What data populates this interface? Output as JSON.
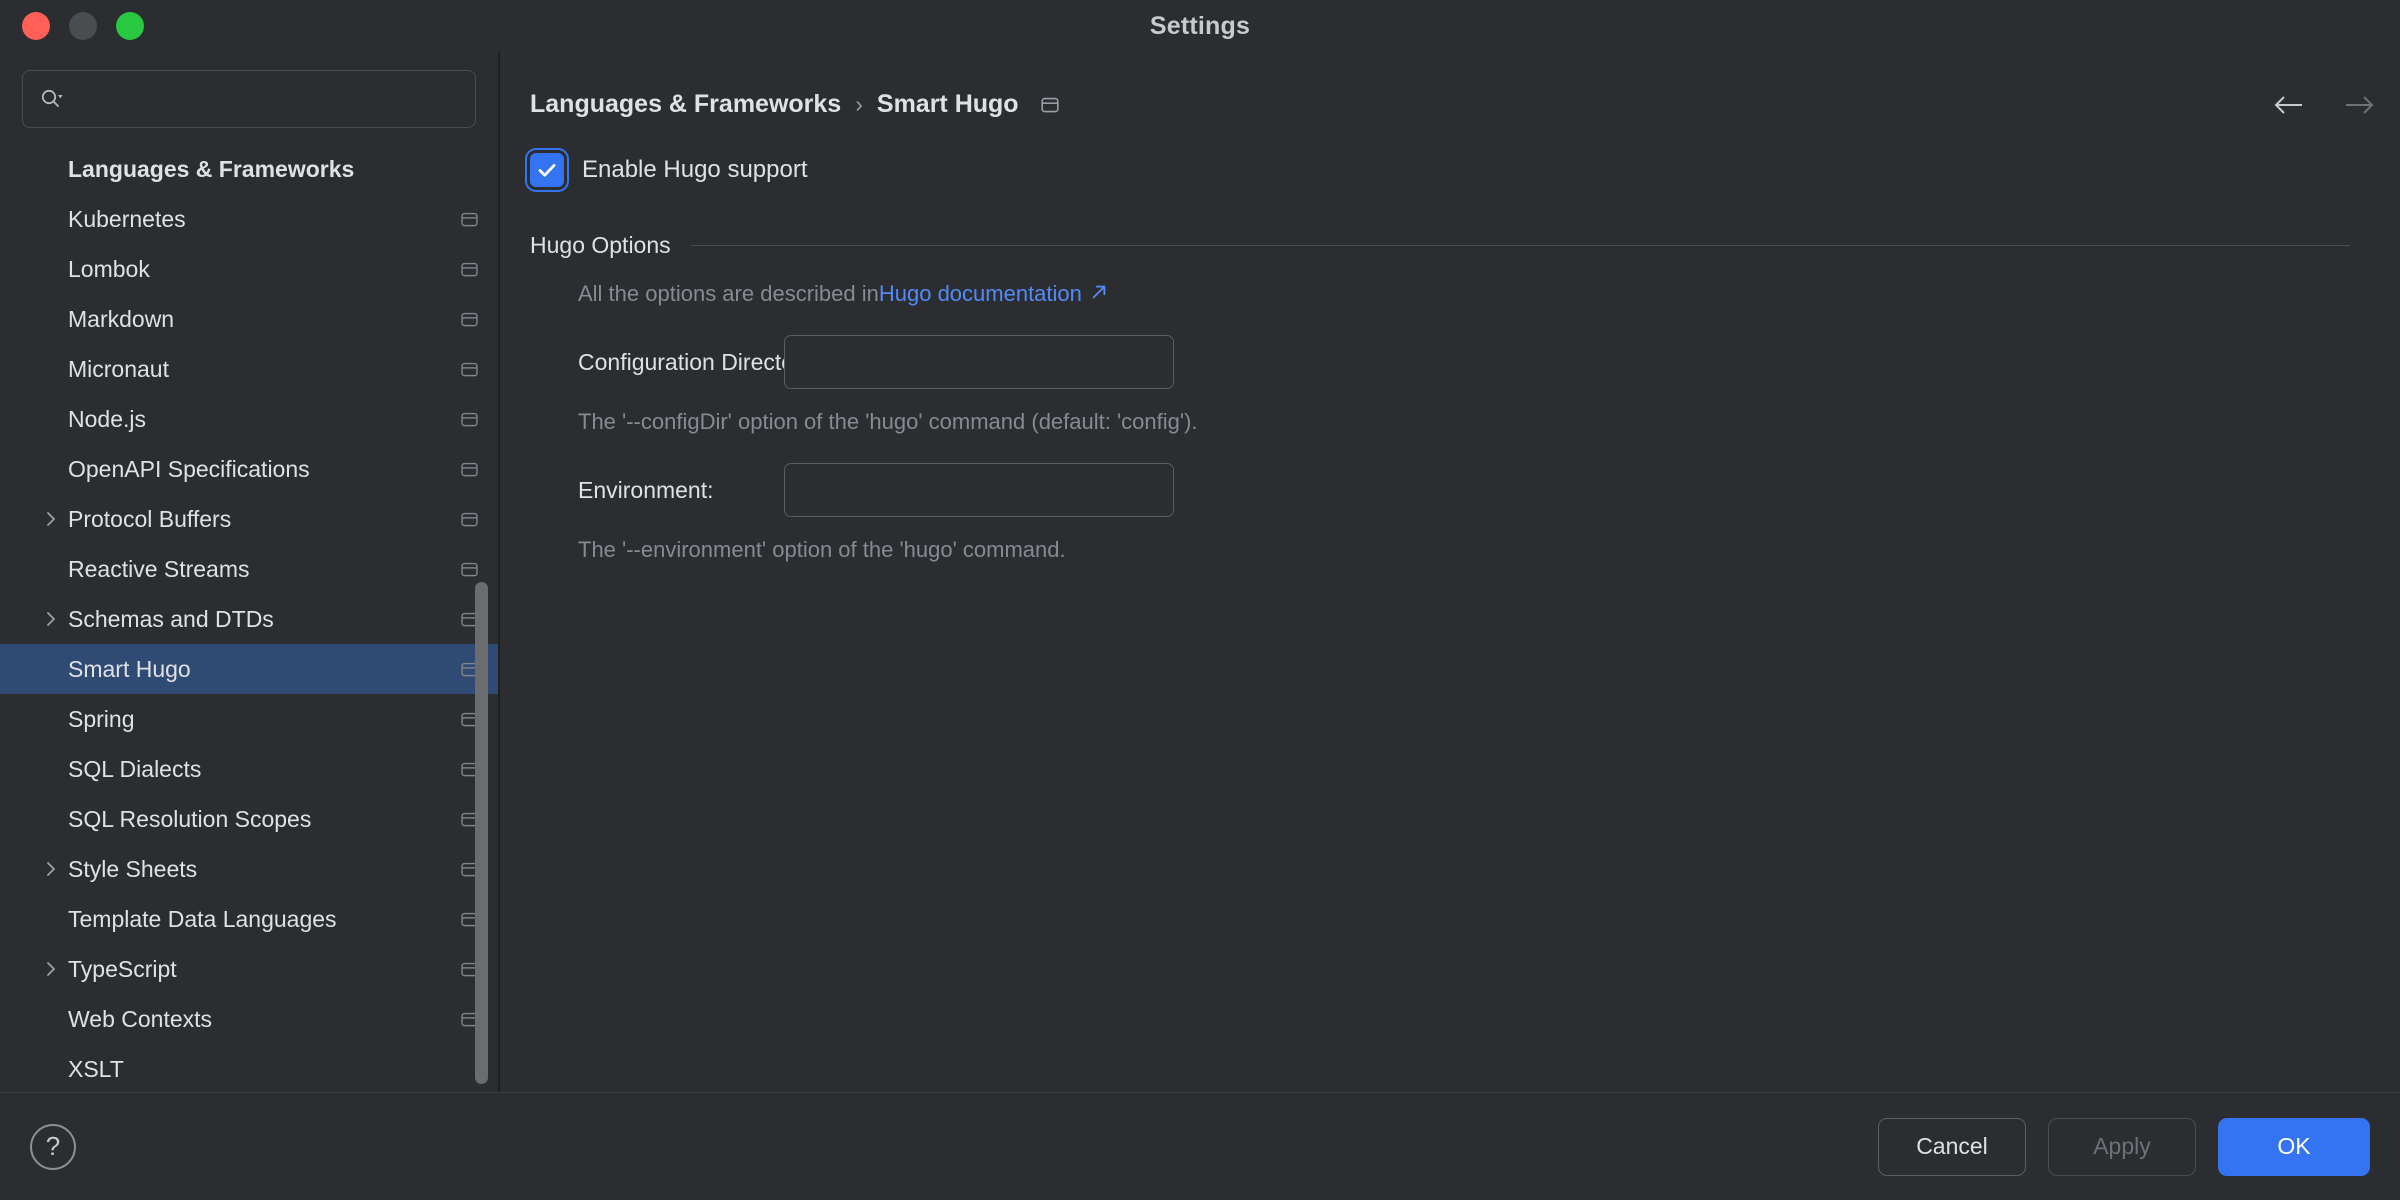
{
  "window": {
    "title": "Settings",
    "traffic_lights": [
      "close",
      "minimize",
      "zoom"
    ]
  },
  "sidebar": {
    "search": {
      "value": "",
      "placeholder": ""
    },
    "group_header": "Languages & Frameworks",
    "items": [
      {
        "label": "Kubernetes",
        "expandable": false,
        "selected": false,
        "scope_icon": true
      },
      {
        "label": "Lombok",
        "expandable": false,
        "selected": false,
        "scope_icon": true
      },
      {
        "label": "Markdown",
        "expandable": false,
        "selected": false,
        "scope_icon": true
      },
      {
        "label": "Micronaut",
        "expandable": false,
        "selected": false,
        "scope_icon": true
      },
      {
        "label": "Node.js",
        "expandable": false,
        "selected": false,
        "scope_icon": true
      },
      {
        "label": "OpenAPI Specifications",
        "expandable": false,
        "selected": false,
        "scope_icon": true
      },
      {
        "label": "Protocol Buffers",
        "expandable": true,
        "selected": false,
        "scope_icon": true
      },
      {
        "label": "Reactive Streams",
        "expandable": false,
        "selected": false,
        "scope_icon": true
      },
      {
        "label": "Schemas and DTDs",
        "expandable": true,
        "selected": false,
        "scope_icon": true
      },
      {
        "label": "Smart Hugo",
        "expandable": false,
        "selected": true,
        "scope_icon": true
      },
      {
        "label": "Spring",
        "expandable": false,
        "selected": false,
        "scope_icon": true
      },
      {
        "label": "SQL Dialects",
        "expandable": false,
        "selected": false,
        "scope_icon": true
      },
      {
        "label": "SQL Resolution Scopes",
        "expandable": false,
        "selected": false,
        "scope_icon": true
      },
      {
        "label": "Style Sheets",
        "expandable": true,
        "selected": false,
        "scope_icon": true
      },
      {
        "label": "Template Data Languages",
        "expandable": false,
        "selected": false,
        "scope_icon": true
      },
      {
        "label": "TypeScript",
        "expandable": true,
        "selected": false,
        "scope_icon": true
      },
      {
        "label": "Web Contexts",
        "expandable": false,
        "selected": false,
        "scope_icon": true
      },
      {
        "label": "XSLT",
        "expandable": false,
        "selected": false,
        "scope_icon": false
      }
    ]
  },
  "breadcrumb": {
    "parent": "Languages & Frameworks",
    "separator": "›",
    "current": "Smart Hugo"
  },
  "nav": {
    "back_enabled": true,
    "forward_enabled": false
  },
  "main": {
    "enable_checkbox": {
      "label": "Enable Hugo support",
      "checked": true
    },
    "group": {
      "title": "Hugo Options",
      "description_prefix": "All the options are described in ",
      "link_text": "Hugo documentation",
      "fields": [
        {
          "label": "Configuration Directory:",
          "value": "",
          "placeholder": "",
          "help": "The '--configDir' option of the 'hugo' command (default: 'config')."
        },
        {
          "label": "Environment:",
          "value": "",
          "placeholder": "",
          "help": "The '--environment' option of the 'hugo' command."
        }
      ]
    }
  },
  "footer": {
    "help_label": "?",
    "cancel_label": "Cancel",
    "apply_label": "Apply",
    "apply_enabled": false,
    "ok_label": "OK"
  },
  "colors": {
    "window_bg": "#2b2d30",
    "selection_blue": "#2f4b73",
    "accent_blue": "#3574f0",
    "link_blue": "#548af7",
    "muted_text": "#868a91",
    "text": "#dfe1e5"
  }
}
